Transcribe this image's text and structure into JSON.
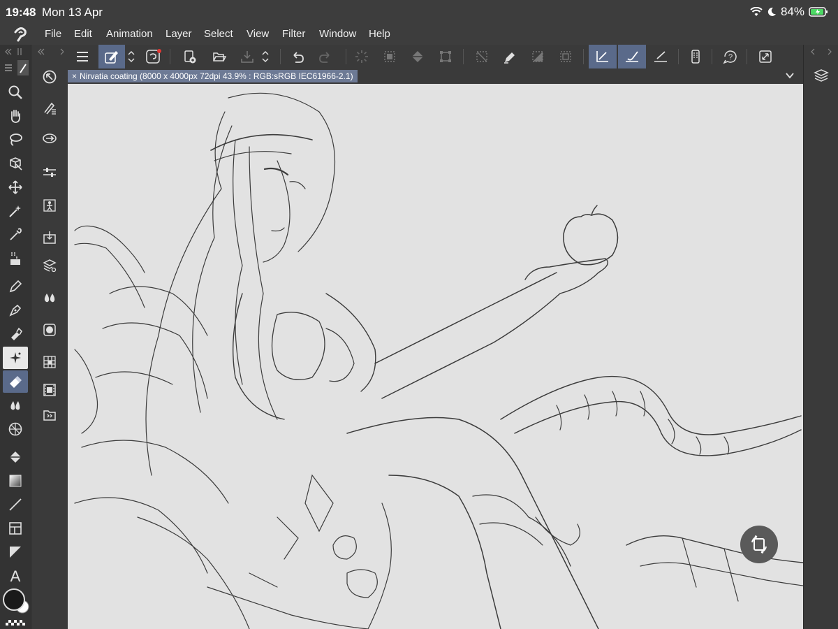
{
  "status": {
    "time": "19:48",
    "date": "Mon 13 Apr",
    "battery": "84%"
  },
  "menu": [
    "File",
    "Edit",
    "Animation",
    "Layer",
    "Select",
    "View",
    "Filter",
    "Window",
    "Help"
  ],
  "tab": {
    "label": "Nirvatia coating (8000 x 4000px 72dpi 43.9% : RGB:sRGB IEC61966-2.1)"
  },
  "left_tools": [
    "zoom-icon",
    "hand-icon",
    "lasso-icon",
    "object-select-icon",
    "move-icon",
    "magic-wand-icon",
    "eyedropper-icon",
    "tone-select-icon",
    "pen-icon",
    "g-pen-icon",
    "marker-icon",
    "sparkle-icon",
    "eraser-icon",
    "blend-icon",
    "perspective-icon",
    "fill-icon",
    "gradient-icon",
    "line-icon",
    "frame-icon",
    "border-icon",
    "text-icon"
  ],
  "sub_tools": [
    "rotate-view-icon",
    "brush-settings-icon",
    "navigation-icon",
    "sliders-icon",
    "figure-icon",
    "import-icon",
    "layers-3d-icon",
    "water-drop-icon",
    "circle-icon",
    "grid-icon",
    "film-icon",
    "material-icon"
  ],
  "toolbar_icons": [
    "menu-icon",
    "edit-tool-icon",
    "chevron-updown-icon",
    "clip-studio-icon",
    "new-icon",
    "open-icon",
    "save-icon",
    "chevron-updown-icon",
    "undo-icon",
    "redo-icon",
    "busy-icon",
    "select-all-icon",
    "fill-icon",
    "transform-icon",
    "deselect-icon",
    "pen-icon",
    "invert-icon",
    "selection-icon",
    "ruler-pen-icon",
    "ruler-brush-icon",
    "ruler-icon",
    "phone-icon",
    "help-icon",
    "fit-icon"
  ],
  "colors": {
    "background": "#3c3c3c",
    "canvas": "#e2e2e2",
    "tab": "#6d7a95",
    "active": "#5a6a8a",
    "foreground_color": "#1a1a1a",
    "background_color": "#ffffff"
  }
}
